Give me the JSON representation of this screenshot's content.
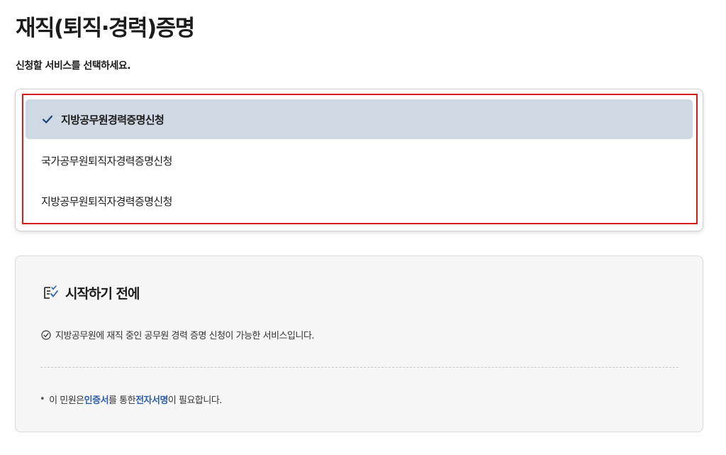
{
  "page": {
    "title": "재직(퇴직·경력)증명",
    "prompt": "신청할 서비스를 선택하세요."
  },
  "options": {
    "items": [
      {
        "label": "지방공무원경력증명신청",
        "selected": true
      },
      {
        "label": "국가공무원퇴직자경력증명신청",
        "selected": false
      },
      {
        "label": "지방공무원퇴직자경력증명신청",
        "selected": false
      }
    ]
  },
  "info": {
    "icon": "checklist-icon",
    "title": "시작하기 전에",
    "notice": {
      "icon": "check-circle-icon",
      "text": "지방공무원에 재직 중인 공무원 경력 증명 신청이 가능한 서비스입니다."
    },
    "note": {
      "bullet": "•",
      "prefix": "이 민원은 ",
      "emph1": "인증서",
      "middle": "를 통한 ",
      "emph2": "전자서명",
      "suffix": "이 필요합니다."
    }
  },
  "colors": {
    "selected_bg": "#cfd9e4",
    "highlight_frame": "#d51d1d",
    "link_blue": "#2c5fa8"
  }
}
